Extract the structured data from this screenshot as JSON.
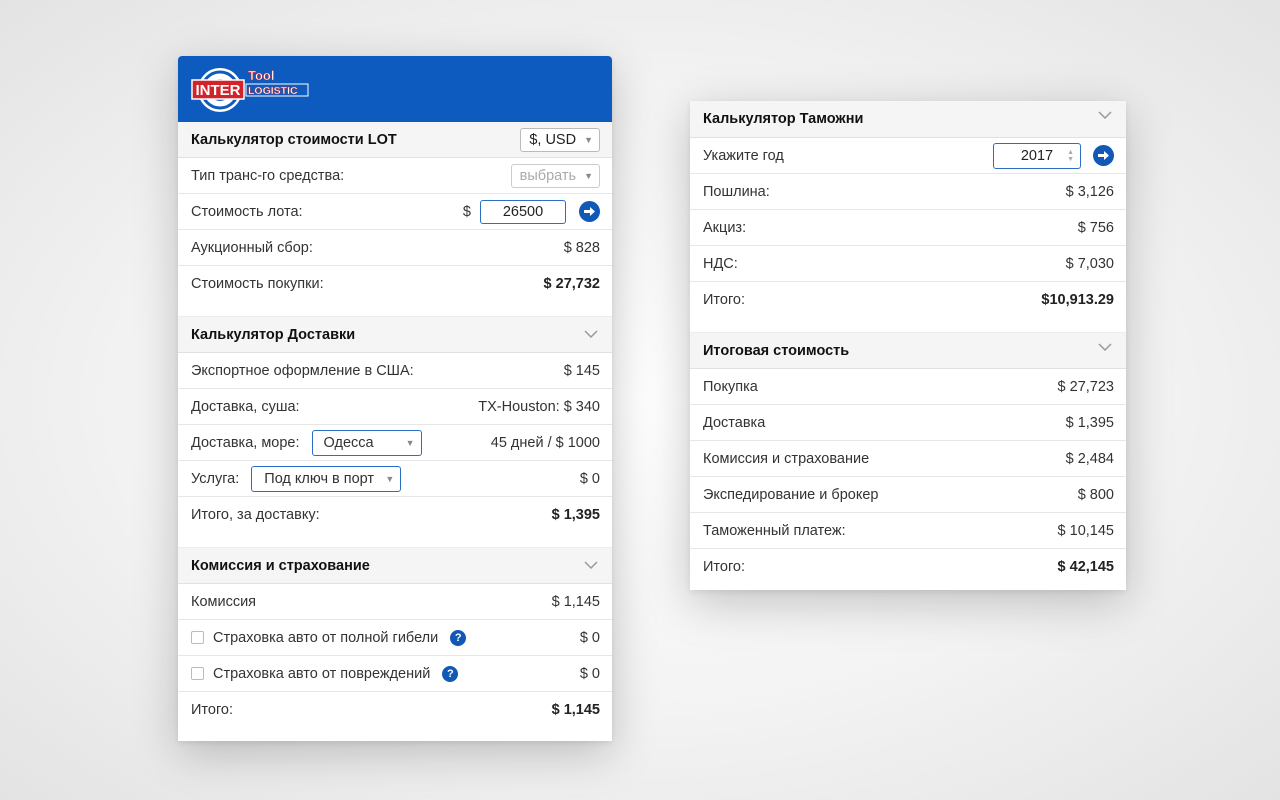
{
  "logo": {
    "inter": "INTER",
    "tool": "Tool",
    "logistic": "LOGISTIC"
  },
  "lot": {
    "title": "Калькулятор стоимости LOT",
    "currency": "$, USD",
    "vehicle_label": "Тип транс-го средства:",
    "vehicle_select": "выбрать",
    "lot_label": "Стоимость лота:",
    "lot_currency": "$",
    "lot_value": "26500",
    "auction_label": "Аукционный сбор:",
    "auction_value": "$ 828",
    "purchase_label": "Стоимость покупки:",
    "purchase_value": "$ 27,732"
  },
  "delivery": {
    "title": "Калькулятор Доставки",
    "export_label": "Экспортное оформление в США:",
    "export_value": "$ 145",
    "land_label": "Доставка, суша:",
    "land_value": "TX-Houston: $ 340",
    "sea_label": "Доставка, море:",
    "sea_port": "Одесса",
    "sea_value": "45 дней / $ 1000",
    "service_label": "Услуга:",
    "service_select": "Под ключ в порт",
    "service_value": "$ 0",
    "total_label": "Итого, за доставку:",
    "total_value": "$ 1,395"
  },
  "commission": {
    "title": "Комиссия и страхование",
    "commission_label": "Комиссия",
    "commission_value": "$ 1,145",
    "ins_total_label": "Страховка авто от полной гибели",
    "ins_total_value": "$ 0",
    "ins_damage_label": "Страховка авто от повреждений",
    "ins_damage_value": "$ 0",
    "total_label": "Итого:",
    "total_value": "$ 1,145"
  },
  "customs": {
    "title": "Калькулятор Таможни",
    "year_label": "Укажите год",
    "year_value": "2017",
    "duty_label": "Пошлина:",
    "duty_value": "$ 3,126",
    "excise_label": "Акциз:",
    "excise_value": "$ 756",
    "vat_label": "НДС:",
    "vat_value": "$ 7,030",
    "total_label": "Итого:",
    "total_value": "$10,913.29"
  },
  "final": {
    "title": "Итоговая стоимость",
    "rows": [
      {
        "label": "Покупка",
        "value": "$ 27,723"
      },
      {
        "label": "Доставка",
        "value": "$ 1,395"
      },
      {
        "label": "Комиссия и страхование",
        "value": "$ 2,484"
      },
      {
        "label": "Экспедирование и брокер",
        "value": "$ 800"
      },
      {
        "label": "Таможенный платеж:",
        "value": "$ 10,145"
      },
      {
        "label": "Итого:",
        "value": "$ 42,145"
      }
    ]
  },
  "colors": {
    "brand_blue": "#0e5bbf",
    "accent_blue": "#1258b5",
    "logo_red": "#d2232a"
  },
  "icons": {
    "go": "arrow-right-circle-icon",
    "help": "question-circle-icon",
    "collapse": "chevron-down-icon"
  }
}
